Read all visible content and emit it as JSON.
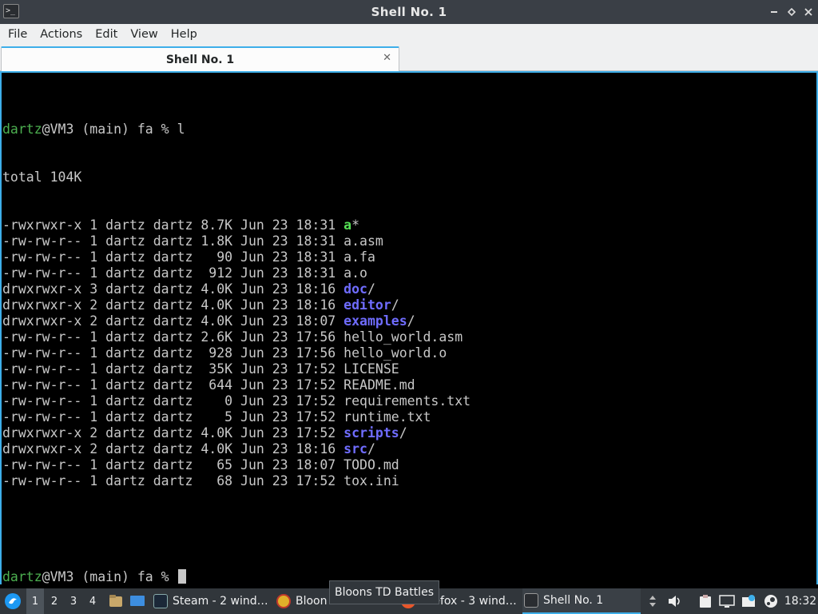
{
  "window": {
    "title": "Shell No. 1",
    "icon": "terminal-icon"
  },
  "menu": [
    "File",
    "Actions",
    "Edit",
    "View",
    "Help"
  ],
  "tab": {
    "label": "Shell No. 1",
    "close_glyph": "✕"
  },
  "terminal": {
    "prompt_user": "dartz",
    "prompt_rest": "@VM3 (main) fa % ",
    "command": "l",
    "total": "total 104K",
    "entries": [
      {
        "meta": "-rwxrwxr-x 1 dartz dartz 8.7K Jun 23 18:31 ",
        "name": "a",
        "suffix": "*",
        "kind": "exe"
      },
      {
        "meta": "-rw-rw-r-- 1 dartz dartz 1.8K Jun 23 18:31 ",
        "name": "a.asm",
        "suffix": "",
        "kind": "file"
      },
      {
        "meta": "-rw-rw-r-- 1 dartz dartz   90 Jun 23 18:31 ",
        "name": "a.fa",
        "suffix": "",
        "kind": "file"
      },
      {
        "meta": "-rw-rw-r-- 1 dartz dartz  912 Jun 23 18:31 ",
        "name": "a.o",
        "suffix": "",
        "kind": "file"
      },
      {
        "meta": "drwxrwxr-x 3 dartz dartz 4.0K Jun 23 18:16 ",
        "name": "doc",
        "suffix": "/",
        "kind": "dir"
      },
      {
        "meta": "drwxrwxr-x 2 dartz dartz 4.0K Jun 23 18:16 ",
        "name": "editor",
        "suffix": "/",
        "kind": "dir"
      },
      {
        "meta": "drwxrwxr-x 2 dartz dartz 4.0K Jun 23 18:07 ",
        "name": "examples",
        "suffix": "/",
        "kind": "dir"
      },
      {
        "meta": "-rw-rw-r-- 1 dartz dartz 2.6K Jun 23 17:56 ",
        "name": "hello_world.asm",
        "suffix": "",
        "kind": "file"
      },
      {
        "meta": "-rw-rw-r-- 1 dartz dartz  928 Jun 23 17:56 ",
        "name": "hello_world.o",
        "suffix": "",
        "kind": "file"
      },
      {
        "meta": "-rw-rw-r-- 1 dartz dartz  35K Jun 23 17:52 ",
        "name": "LICENSE",
        "suffix": "",
        "kind": "file"
      },
      {
        "meta": "-rw-rw-r-- 1 dartz dartz  644 Jun 23 17:52 ",
        "name": "README.md",
        "suffix": "",
        "kind": "file"
      },
      {
        "meta": "-rw-rw-r-- 1 dartz dartz    0 Jun 23 17:52 ",
        "name": "requirements.txt",
        "suffix": "",
        "kind": "file"
      },
      {
        "meta": "-rw-rw-r-- 1 dartz dartz    5 Jun 23 17:52 ",
        "name": "runtime.txt",
        "suffix": "",
        "kind": "file"
      },
      {
        "meta": "drwxrwxr-x 2 dartz dartz 4.0K Jun 23 17:52 ",
        "name": "scripts",
        "suffix": "/",
        "kind": "dir"
      },
      {
        "meta": "drwxrwxr-x 2 dartz dartz 4.0K Jun 23 18:16 ",
        "name": "src",
        "suffix": "/",
        "kind": "dir"
      },
      {
        "meta": "-rw-rw-r-- 1 dartz dartz   65 Jun 23 18:07 ",
        "name": "TODO.md",
        "suffix": "",
        "kind": "file"
      },
      {
        "meta": "-rw-rw-r-- 1 dartz dartz   68 Jun 23 17:52 ",
        "name": "tox.ini",
        "suffix": "",
        "kind": "file"
      }
    ]
  },
  "taskbar": {
    "desktops": [
      "1",
      "2",
      "3",
      "4"
    ],
    "tasks": [
      {
        "label": "Steam - 2 wind…",
        "icon": "steam-icon"
      },
      {
        "label": "Bloon",
        "icon": "bloons-icon"
      },
      {
        "label": "Firefox - 3 wind…",
        "icon": "firefox-icon"
      },
      {
        "label": "Shell No. 1",
        "icon": "terminal-icon"
      }
    ],
    "tooltip": "Bloons TD Battles",
    "clock": "18:32"
  },
  "colors": {
    "accent": "#3daee9",
    "prompt_user": "#4caf50",
    "directory": "#6f6cff",
    "executable": "#55e055"
  }
}
